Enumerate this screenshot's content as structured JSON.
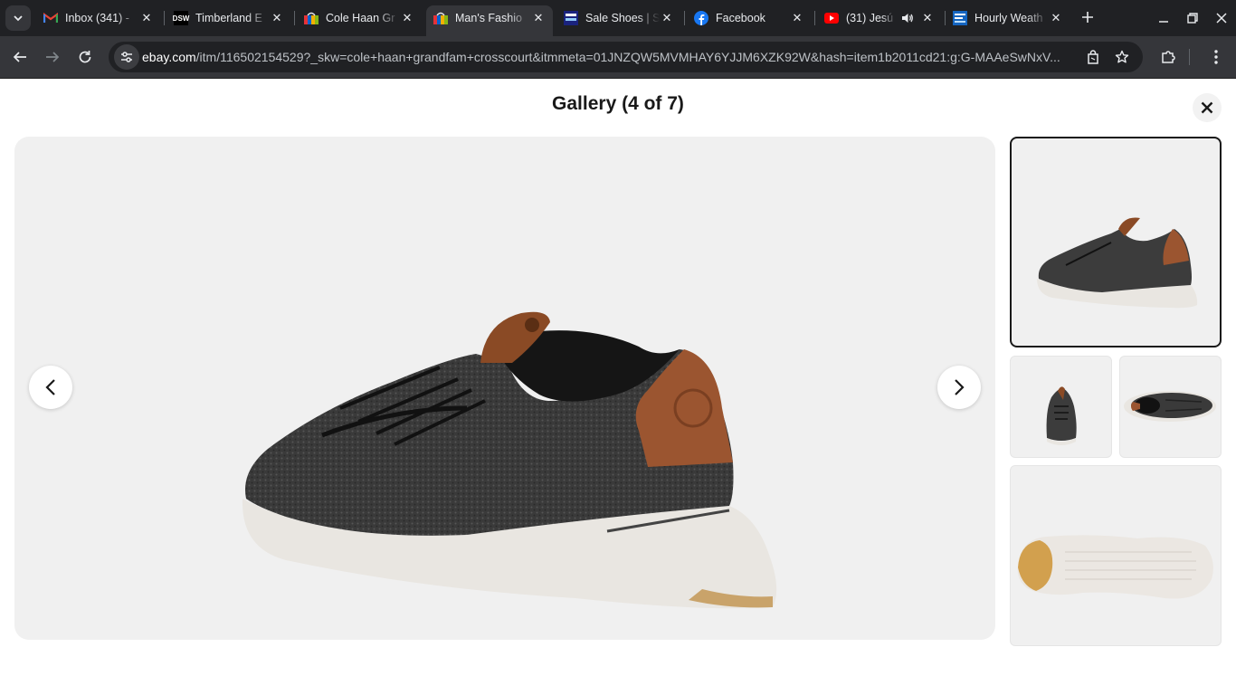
{
  "browser": {
    "tabs": [
      {
        "title": "Inbox (341) - ",
        "favicon": "gmail-icon"
      },
      {
        "title": "Timberland E",
        "favicon": "dsw-icon",
        "favicon_text": "DSW"
      },
      {
        "title": "Cole Haan Gr",
        "favicon": "ebay-icon"
      },
      {
        "title": "Man's Fashio",
        "favicon": "ebay-icon",
        "active": true
      },
      {
        "title": "Sale Shoes | S",
        "favicon": "shoes-site-icon"
      },
      {
        "title": "Facebook",
        "favicon": "facebook-icon"
      },
      {
        "title": "(31) Jesú",
        "favicon": "youtube-icon",
        "audio": true
      },
      {
        "title": "Hourly Weath",
        "favicon": "weather-icon"
      }
    ],
    "url": {
      "host": "ebay.com",
      "path": "/itm/116502154529?_skw=cole+haan+grandfam+crosscourt&itmmeta=01JNZQW5MVMHAY6YJJM6XZK92W&hash=item1b2011cd21:g:G-MAAeSwNxV..."
    }
  },
  "gallery": {
    "title": "Gallery (4 of 7)",
    "close_label": "Close gallery",
    "prev_label": "Previous image",
    "next_label": "Next image",
    "main_image": "sneaker-side-rear-view",
    "thumbnails": [
      {
        "name": "thumb-side-rear-view",
        "selected": true
      },
      {
        "name": "thumb-front-view",
        "selected": false
      },
      {
        "name": "thumb-top-view",
        "selected": false
      },
      {
        "name": "thumb-sole-view",
        "selected": false
      }
    ]
  },
  "colors": {
    "chrome_dark": "#202124",
    "chrome_toolbar": "#35363a",
    "gallery_bg": "#f0f0f0",
    "title_text": "#191919"
  }
}
